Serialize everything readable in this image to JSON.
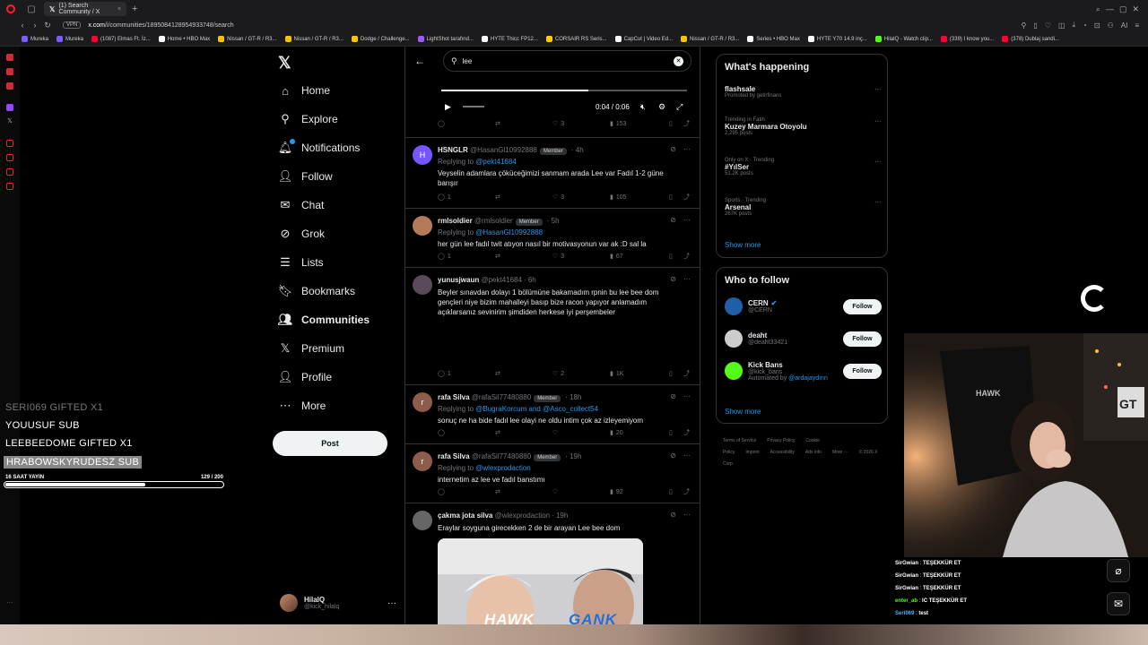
{
  "browser": {
    "tab_title": "(1) Search Community / X",
    "url_prefix": "x.com",
    "url_path": "/i/communities/1895084128954933748/search",
    "vpn": "VPN",
    "bookmarks": [
      {
        "label": "Mureka",
        "color": "#7b5cff"
      },
      {
        "label": "Mureka",
        "color": "#7b5cff"
      },
      {
        "label": "(1087) Elmas Ft. İz...",
        "color": "#ff0033"
      },
      {
        "label": "Home • HBO Max",
        "color": "#ffffff"
      },
      {
        "label": "Nissan / GT-R / R3...",
        "color": "#f5c400"
      },
      {
        "label": "Nissan / GT-R / R3...",
        "color": "#f5c400"
      },
      {
        "label": "Dodge / Challenge...",
        "color": "#f5c400"
      },
      {
        "label": "LightShot tarafınd...",
        "color": "#9b59ff"
      },
      {
        "label": "HYTE Thicc FP12...",
        "color": "#ffffff"
      },
      {
        "label": "CORSAIR RS Seris...",
        "color": "#ffcc00"
      },
      {
        "label": "CapCut | Video Ed...",
        "color": "#ffffff"
      },
      {
        "label": "Nissan / GT-R / R3...",
        "color": "#f5c400"
      },
      {
        "label": "Series • HBO Max",
        "color": "#ffffff"
      },
      {
        "label": "HYTE Y70 14.9 inç...",
        "color": "#ffffff"
      },
      {
        "label": "HilalQ - Watch clip...",
        "color": "#53fc18"
      },
      {
        "label": "(339) I know you...",
        "color": "#ff0033"
      },
      {
        "label": "(378) Dublaj sandi...",
        "color": "#ff0033"
      }
    ]
  },
  "nav": {
    "items": [
      {
        "label": "Home",
        "icon": "home-icon",
        "glyph": "⌂"
      },
      {
        "label": "Explore",
        "icon": "search-icon",
        "glyph": "⚲"
      },
      {
        "label": "Notifications",
        "icon": "bell-icon",
        "glyph": "🔔︎"
      },
      {
        "label": "Follow",
        "icon": "person-plus-icon",
        "glyph": "👤︎"
      },
      {
        "label": "Chat",
        "icon": "envelope-icon",
        "glyph": "✉"
      },
      {
        "label": "Grok",
        "icon": "grok-icon",
        "glyph": "⊘"
      },
      {
        "label": "Lists",
        "icon": "list-icon",
        "glyph": "☰"
      },
      {
        "label": "Bookmarks",
        "icon": "bookmark-icon",
        "glyph": "🔖︎"
      },
      {
        "label": "Communities",
        "icon": "communities-icon",
        "glyph": "👥︎"
      },
      {
        "label": "Premium",
        "icon": "x-premium-icon",
        "glyph": "𝕏"
      },
      {
        "label": "Profile",
        "icon": "profile-icon",
        "glyph": "👤︎"
      },
      {
        "label": "More",
        "icon": "more-circle-icon",
        "glyph": "⋯"
      }
    ],
    "post_label": "Post",
    "account": {
      "name": "HilalQ",
      "handle": "@kick_hilalq"
    }
  },
  "search": {
    "value": "lee"
  },
  "video": {
    "time": "0:04 / 0:06"
  },
  "first_actions": {
    "likes": "3",
    "views": "153"
  },
  "tweets": [
    {
      "name": "HSNGLR",
      "handle": "@HasanGl10992888",
      "badge": "Member",
      "time": "· 4h",
      "reply_to": "Replying to",
      "reply_handle": "@pekt41684",
      "text": "Veyselin adamlara çöküceğimizi sanmam arada Lee var Fadıl 1-2  güne barışır",
      "replies": "1",
      "likes": "3",
      "views": "105",
      "avatar_letter": "H",
      "avatar_color": "#7856ff"
    },
    {
      "name": "rmlsoldier",
      "handle": "@rmlsoldier",
      "badge": "Member",
      "time": "· 5h",
      "reply_to": "Replying to",
      "reply_handle": "@HasanGl10992888",
      "text": "her gün lee fadıl twit atıyon nasıl bir motivasyonun var ak :D sal la",
      "replies": "1",
      "likes": "3",
      "views": "67",
      "avatar_letter": "",
      "avatar_color": "#b57a5a"
    },
    {
      "name": "yunusjwaun",
      "handle": "@pekt41684",
      "badge": "",
      "time": "· 6h",
      "reply_to": "",
      "reply_handle": "",
      "text": "Beyler sınavdan dolayı 1 bölümüne bakamadım rpnin bu lee bee dom gençleri niye bizim mahalleyi basıp bize racon yapıyor anlamadım açıklarsanız sevinirim şimdiden herkese iyi perşembeler",
      "replies": "1",
      "likes": "2",
      "views": "1K",
      "avatar_letter": "",
      "avatar_color": "#5a4a5a"
    },
    {
      "name": "rafa Silva",
      "handle": "@rafaSil77480880",
      "badge": "Member",
      "time": "· 18h",
      "reply_to": "Replying to",
      "reply_handle": "@BugraKorcum and @Asco_collect54",
      "text": "sonuç ne ha bide fadıl lee olayi ne oldu intim çok az izleyemiyom",
      "replies": "",
      "likes": "",
      "views": "20",
      "avatar_letter": "r",
      "avatar_color": "#8d5c4a"
    },
    {
      "name": "rafa Silva",
      "handle": "@rafaSil77480880",
      "badge": "Member",
      "time": "· 19h",
      "reply_to": "Replying to",
      "reply_handle": "@wlexprodaction",
      "text": "internetim az lee ve fadıl banstımı",
      "replies": "",
      "likes": "",
      "views": "92",
      "avatar_letter": "r",
      "avatar_color": "#8d5c4a"
    },
    {
      "name": "çakma jota silva",
      "handle": "@wlexprodaction",
      "badge": "",
      "time": "· 19h",
      "reply_to": "",
      "reply_handle": "",
      "text": "Eraylar soyguna girecekken 2 de bir arayan Lee bee dom",
      "replies": "",
      "likes": "",
      "views": "",
      "avatar_letter": "",
      "avatar_color": "#666666"
    }
  ],
  "happening": {
    "title": "What's happening",
    "trends": [
      {
        "meta": "",
        "title": "flashsale",
        "count": "Promoted by getirfinans"
      },
      {
        "meta": "Trending in Fatih",
        "title": "Kuzey Marmara Otoyolu",
        "count": "2,295 posts"
      },
      {
        "meta": "Only on X · Trending",
        "title": "#YılSer",
        "count": "51.2K posts"
      },
      {
        "meta": "Sports · Trending",
        "title": "Arsenal",
        "count": "267K posts"
      }
    ],
    "show_more": "Show more"
  },
  "who_to_follow": {
    "title": "Who to follow",
    "accounts": [
      {
        "name": "CERN",
        "handle": "@CERN",
        "extra": "",
        "extra_link": "",
        "color": "#1f5fa8"
      },
      {
        "name": "deaht",
        "handle": "@deaht33421",
        "extra": "",
        "extra_link": "",
        "color": "#cccccc"
      },
      {
        "name": "Kick Bans",
        "handle": "@kick_bans",
        "extra": "Automated by",
        "extra_link": "@ardajaydınn",
        "color": "#53fc18"
      }
    ],
    "follow_label": "Follow",
    "show_more": "Show more"
  },
  "footer_links": [
    "Terms of Service",
    "Privacy Policy",
    "Cookie Policy",
    "Imprint",
    "Accessibility",
    "Ads info",
    "More ···",
    "© 2026 X Corp."
  ],
  "overlay": {
    "subs": [
      {
        "text": "SERI069  GIFTED X1",
        "style": "faded"
      },
      {
        "text": "YOUUSUF  SUB",
        "style": "normal"
      },
      {
        "text": "LEEBEEDOME  GIFTED X1",
        "style": "normal"
      },
      {
        "text": "HRABOWSKYRUDESZ  SUB",
        "style": "hl"
      }
    ],
    "goal_label": "16 SAAT YAYIN",
    "goal_current": "129",
    "goal_target": "/ 200",
    "goal_fraction": 0.645
  },
  "chat": [
    {
      "user": "SirGwian",
      "msg": "TEŞEKKÜR ET",
      "color": "#ffffff"
    },
    {
      "user": "SirGwian",
      "msg": "TEŞEKKÜR ET",
      "color": "#ffffff"
    },
    {
      "user": "SirGwian",
      "msg": "TEŞEKKÜR ET",
      "color": "#ffffff"
    },
    {
      "user": "enter_ab",
      "msg": "IC TEŞEKKÜR ET",
      "color": "#53fc18"
    },
    {
      "user": "Seri069",
      "msg": "test",
      "color": "#53b3fc"
    }
  ],
  "sponsors": {
    "hawk": "HAWK",
    "gank": "GANK"
  },
  "colors": {
    "accent": "#1d9bf0",
    "bg": "#000000",
    "border": "#2f3336",
    "kick_green": "#53fc18"
  }
}
